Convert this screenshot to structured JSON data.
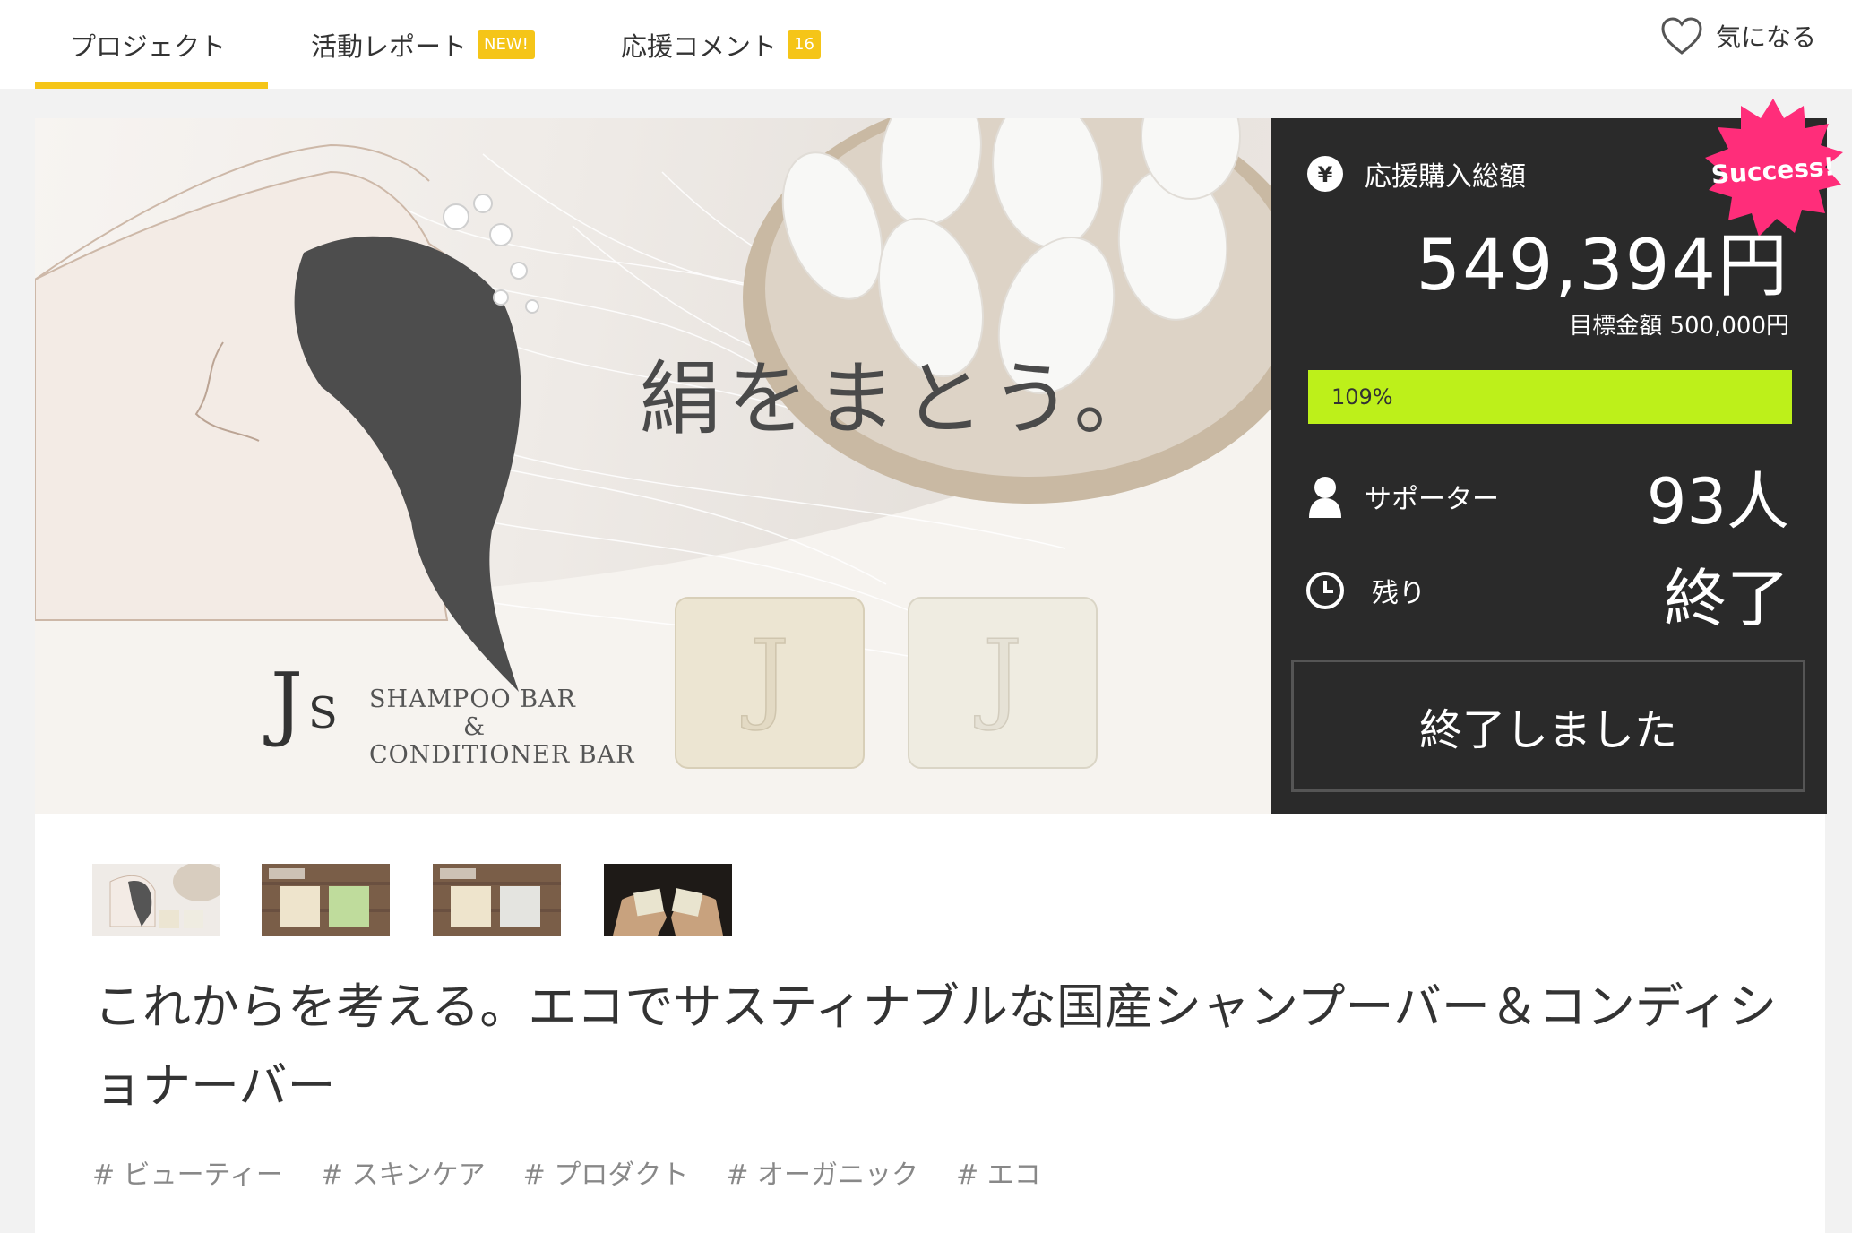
{
  "tabs": [
    {
      "label": "プロジェクト"
    },
    {
      "label": "活動レポート",
      "badge": "NEW!"
    },
    {
      "label": "応援コメント",
      "badge": "16"
    }
  ],
  "favorite": {
    "label": "気になる"
  },
  "hero": {
    "caption": "絹をまとう。",
    "brand_mark": "J",
    "brand_mark_s": "S",
    "brand_line1": "SHAMPOO BAR",
    "brand_amp": "&",
    "brand_line2": "CONDITIONER BAR"
  },
  "stats": {
    "success_badge": "Success!",
    "total_label": "応援購入総額",
    "total_amount": "549,394円",
    "goal_text": "目標金額 500,000円",
    "progress_text": "109%",
    "progress_fraction": 1.0,
    "supporters_label": "サポーター",
    "supporters_value": "93人",
    "remaining_label": "残り",
    "remaining_value": "終了",
    "end_button": "終了しました"
  },
  "title": "これからを考える。エコでサスティナブルな国産シャンプーバー＆コンディショナーバー",
  "tags": [
    "# ビューティー",
    "# スキンケア",
    "# プロダクト",
    "# オーガニック",
    "# エコ"
  ],
  "colors": {
    "accent": "#f5c518",
    "progress": "#bdf01a",
    "success": "#ff2d7a",
    "panel": "#2a2a2a"
  }
}
